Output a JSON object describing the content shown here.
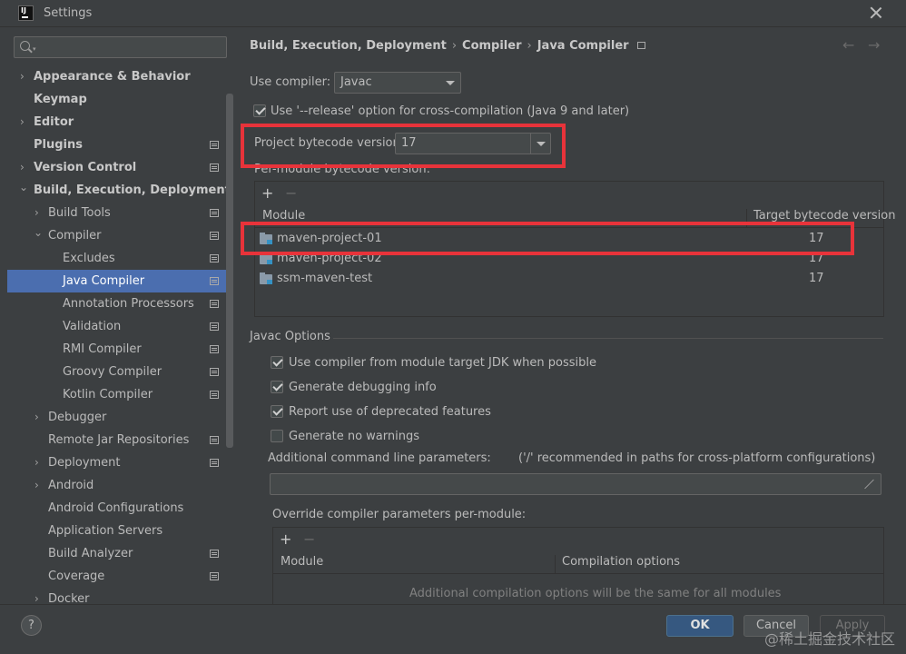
{
  "window": {
    "title": "Settings",
    "logo_text": "IJ"
  },
  "sidebar": {
    "search": {
      "placeholder": "",
      "value": ""
    },
    "items": [
      {
        "label": "Appearance & Behavior",
        "arrow": "›"
      },
      {
        "label": "Keymap",
        "arrow": ""
      },
      {
        "label": "Editor",
        "arrow": "›"
      },
      {
        "label": "Plugins",
        "arrow": ""
      },
      {
        "label": "Version Control",
        "arrow": "›"
      },
      {
        "label": "Build, Execution, Deployment",
        "arrow": "⌄"
      },
      {
        "label": "Build Tools",
        "arrow": "›"
      },
      {
        "label": "Compiler",
        "arrow": "⌄"
      },
      {
        "label": "Excludes",
        "arrow": ""
      },
      {
        "label": "Java Compiler",
        "arrow": ""
      },
      {
        "label": "Annotation Processors",
        "arrow": ""
      },
      {
        "label": "Validation",
        "arrow": ""
      },
      {
        "label": "RMI Compiler",
        "arrow": ""
      },
      {
        "label": "Groovy Compiler",
        "arrow": ""
      },
      {
        "label": "Kotlin Compiler",
        "arrow": ""
      },
      {
        "label": "Debugger",
        "arrow": "›"
      },
      {
        "label": "Remote Jar Repositories",
        "arrow": ""
      },
      {
        "label": "Deployment",
        "arrow": "›"
      },
      {
        "label": "Android",
        "arrow": "›"
      },
      {
        "label": "Android Configurations",
        "arrow": ""
      },
      {
        "label": "Application Servers",
        "arrow": ""
      },
      {
        "label": "Build Analyzer",
        "arrow": ""
      },
      {
        "label": "Coverage",
        "arrow": ""
      },
      {
        "label": "Docker",
        "arrow": "›"
      }
    ]
  },
  "breadcrumb": [
    "Build, Execution, Deployment",
    "Compiler",
    "Java Compiler"
  ],
  "breadcrumb_sep": "›",
  "nav": {
    "back": "←",
    "forward": "→"
  },
  "compiler": {
    "use_compiler_label": "Use compiler:",
    "use_compiler_value": "Javac",
    "release_option_label": "Use '--release' option for cross-compilation (Java 9 and later)",
    "bytecode_label": "Project bytecode version:",
    "bytecode_value": "17",
    "per_module_label": "Per-module bytecode version:"
  },
  "module_table": {
    "add": "+",
    "remove": "−",
    "columns": [
      "Module",
      "Target bytecode version"
    ],
    "rows": [
      {
        "module": "maven-project-01",
        "version": "17"
      },
      {
        "module": "maven-project-02",
        "version": "17"
      },
      {
        "module": "ssm-maven-test",
        "version": "17"
      }
    ]
  },
  "javac": {
    "section_title": "Javac Options",
    "options": [
      {
        "label": "Use compiler from module target JDK when possible",
        "checked": true
      },
      {
        "label": "Generate debugging info",
        "checked": true
      },
      {
        "label": "Report use of deprecated features",
        "checked": true
      },
      {
        "label": "Generate no warnings",
        "checked": false
      }
    ],
    "additional_params_label": "Additional command line parameters:",
    "additional_params_hint": "('/' recommended in paths for cross-platform configurations)",
    "additional_params_value": "",
    "override_label": "Override compiler parameters per-module:"
  },
  "override_table": {
    "add": "+",
    "remove": "−",
    "columns": [
      "Module",
      "Compilation options"
    ],
    "empty_text": "Additional compilation options will be the same for all modules"
  },
  "footer": {
    "help": "?",
    "ok": "OK",
    "cancel": "Cancel",
    "apply": "Apply",
    "watermark": "@稀土掘金技术社区"
  },
  "colors": {
    "background": "#3c3f41",
    "selection": "#4b6eaf",
    "ok_button": "#365880",
    "highlight_box": "#e8333a"
  }
}
